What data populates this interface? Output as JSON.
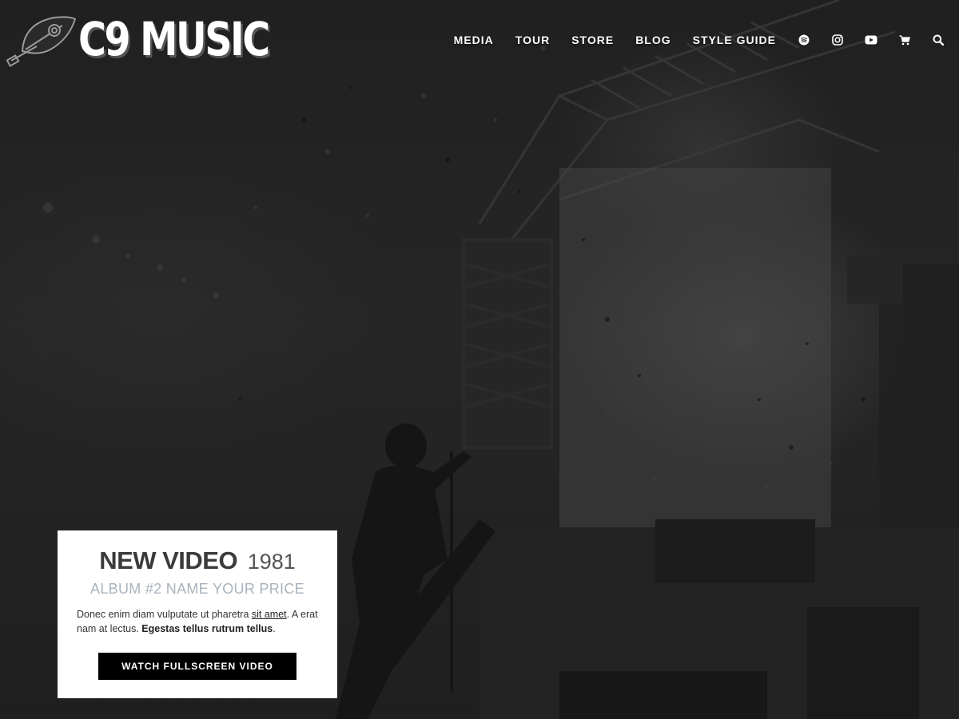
{
  "brand": {
    "name": "C9 MUSIC",
    "logo_icon": "guitar-feather-icon"
  },
  "nav": {
    "links": [
      "MEDIA",
      "TOUR",
      "STORE",
      "BLOG",
      "STYLE GUIDE"
    ],
    "icons": [
      "spotify-icon",
      "instagram-icon",
      "youtube-icon",
      "cart-icon",
      "search-icon"
    ]
  },
  "feature": {
    "title_strong": "NEW VIDEO",
    "title_year": "1981",
    "subtitle": "ALBUM #2 NAME YOUR PRICE",
    "body_start": "Donec enim diam vulputate ut pharetra ",
    "body_link": "sit amet",
    "body_middle": ". A erat nam at lectus. ",
    "body_bold": "Egestas tellus rutrum tellus",
    "body_end": ".",
    "button_label": "WATCH FULLSCREEN VIDEO"
  },
  "colors": {
    "background": "#1e1e1e",
    "card": "#ffffff",
    "button": "#000000",
    "subtitle": "#a9b3bd"
  }
}
